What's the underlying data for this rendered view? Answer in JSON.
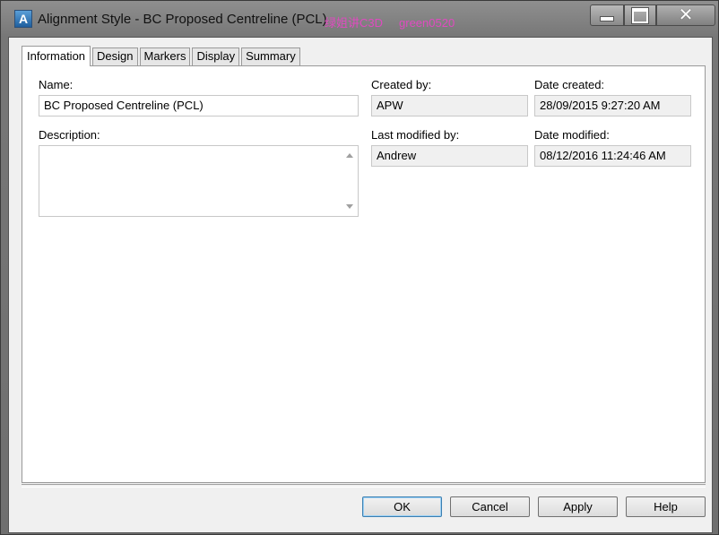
{
  "window": {
    "title": "Alignment Style - BC Proposed Centreline (PCL)",
    "watermark_cn": "绿姐讲C3D",
    "watermark_id": "green0520",
    "app_icon_glyph": "A"
  },
  "tabs": [
    "Information",
    "Design",
    "Markers",
    "Display",
    "Summary"
  ],
  "active_tab": "Information",
  "form": {
    "name_label": "Name:",
    "name_value": "BC Proposed Centreline (PCL)",
    "description_label": "Description:",
    "description_value": "",
    "created_by_label": "Created by:",
    "created_by_value": "APW",
    "date_created_label": "Date created:",
    "date_created_value": "28/09/2015 9:27:20 AM",
    "last_modified_by_label": "Last modified by:",
    "last_modified_by_value": "Andrew",
    "date_modified_label": "Date modified:",
    "date_modified_value": "08/12/2016 11:24:46 AM"
  },
  "buttons": {
    "ok": "OK",
    "cancel": "Cancel",
    "apply": "Apply",
    "help": "Help"
  },
  "icons": {
    "app": "autocad-civil3d-icon",
    "minimize": "minimize-icon",
    "maximize": "maximize-icon",
    "close": "close-icon"
  },
  "colors": {
    "watermark": "#e04ac0",
    "titlebar": "#8f8f8f",
    "dialog_bg": "#f0f0f0"
  }
}
